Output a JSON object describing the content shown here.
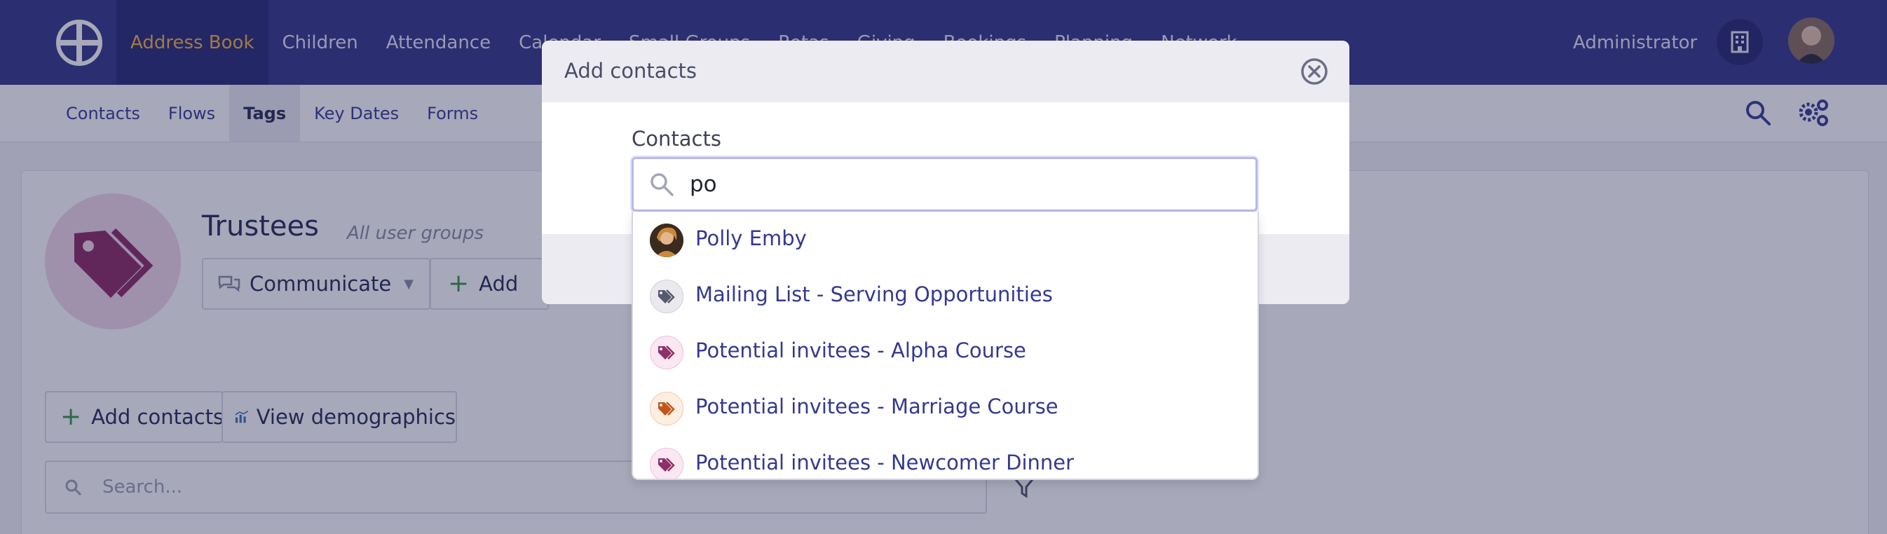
{
  "topnav": {
    "items": [
      "Address Book",
      "Children",
      "Attendance",
      "Calendar",
      "Small Groups",
      "Rotas",
      "Giving",
      "Bookings",
      "Planning",
      "Network"
    ],
    "active_index": 0,
    "user": "Administrator"
  },
  "subnav": {
    "items": [
      "Contacts",
      "Flows",
      "Tags",
      "Key Dates",
      "Forms"
    ],
    "active_index": 2
  },
  "page": {
    "title": "Trustees",
    "subtitle": "All user groups",
    "communicate_label": "Communicate",
    "add_label": "Add",
    "add_contacts_label": "Add contacts",
    "view_demographics_label": "View demographics",
    "search_placeholder": "Search..."
  },
  "modal": {
    "title": "Add contacts",
    "field_label": "Contacts",
    "search_value": "po"
  },
  "dropdown": {
    "options": [
      {
        "label": "Polly Emby",
        "icon": "person-avatar",
        "color": "#b07a3a"
      },
      {
        "label": "Mailing List - Serving Opportunities",
        "icon": "tag-icon",
        "color": "#555a6e"
      },
      {
        "label": "Potential invitees - Alpha Course",
        "icon": "tag-icon",
        "color": "#8e2f66"
      },
      {
        "label": "Potential invitees - Marriage Course",
        "icon": "tag-icon",
        "color": "#c2561a"
      },
      {
        "label": "Potential invitees - Newcomer Dinner",
        "icon": "tag-icon",
        "color": "#8e2f66"
      }
    ]
  },
  "colors": {
    "nav_bg": "#373a8a",
    "active_nav_text": "#f3b63f",
    "tag_purple": "#8e2f66",
    "link_blue": "#34398f"
  }
}
